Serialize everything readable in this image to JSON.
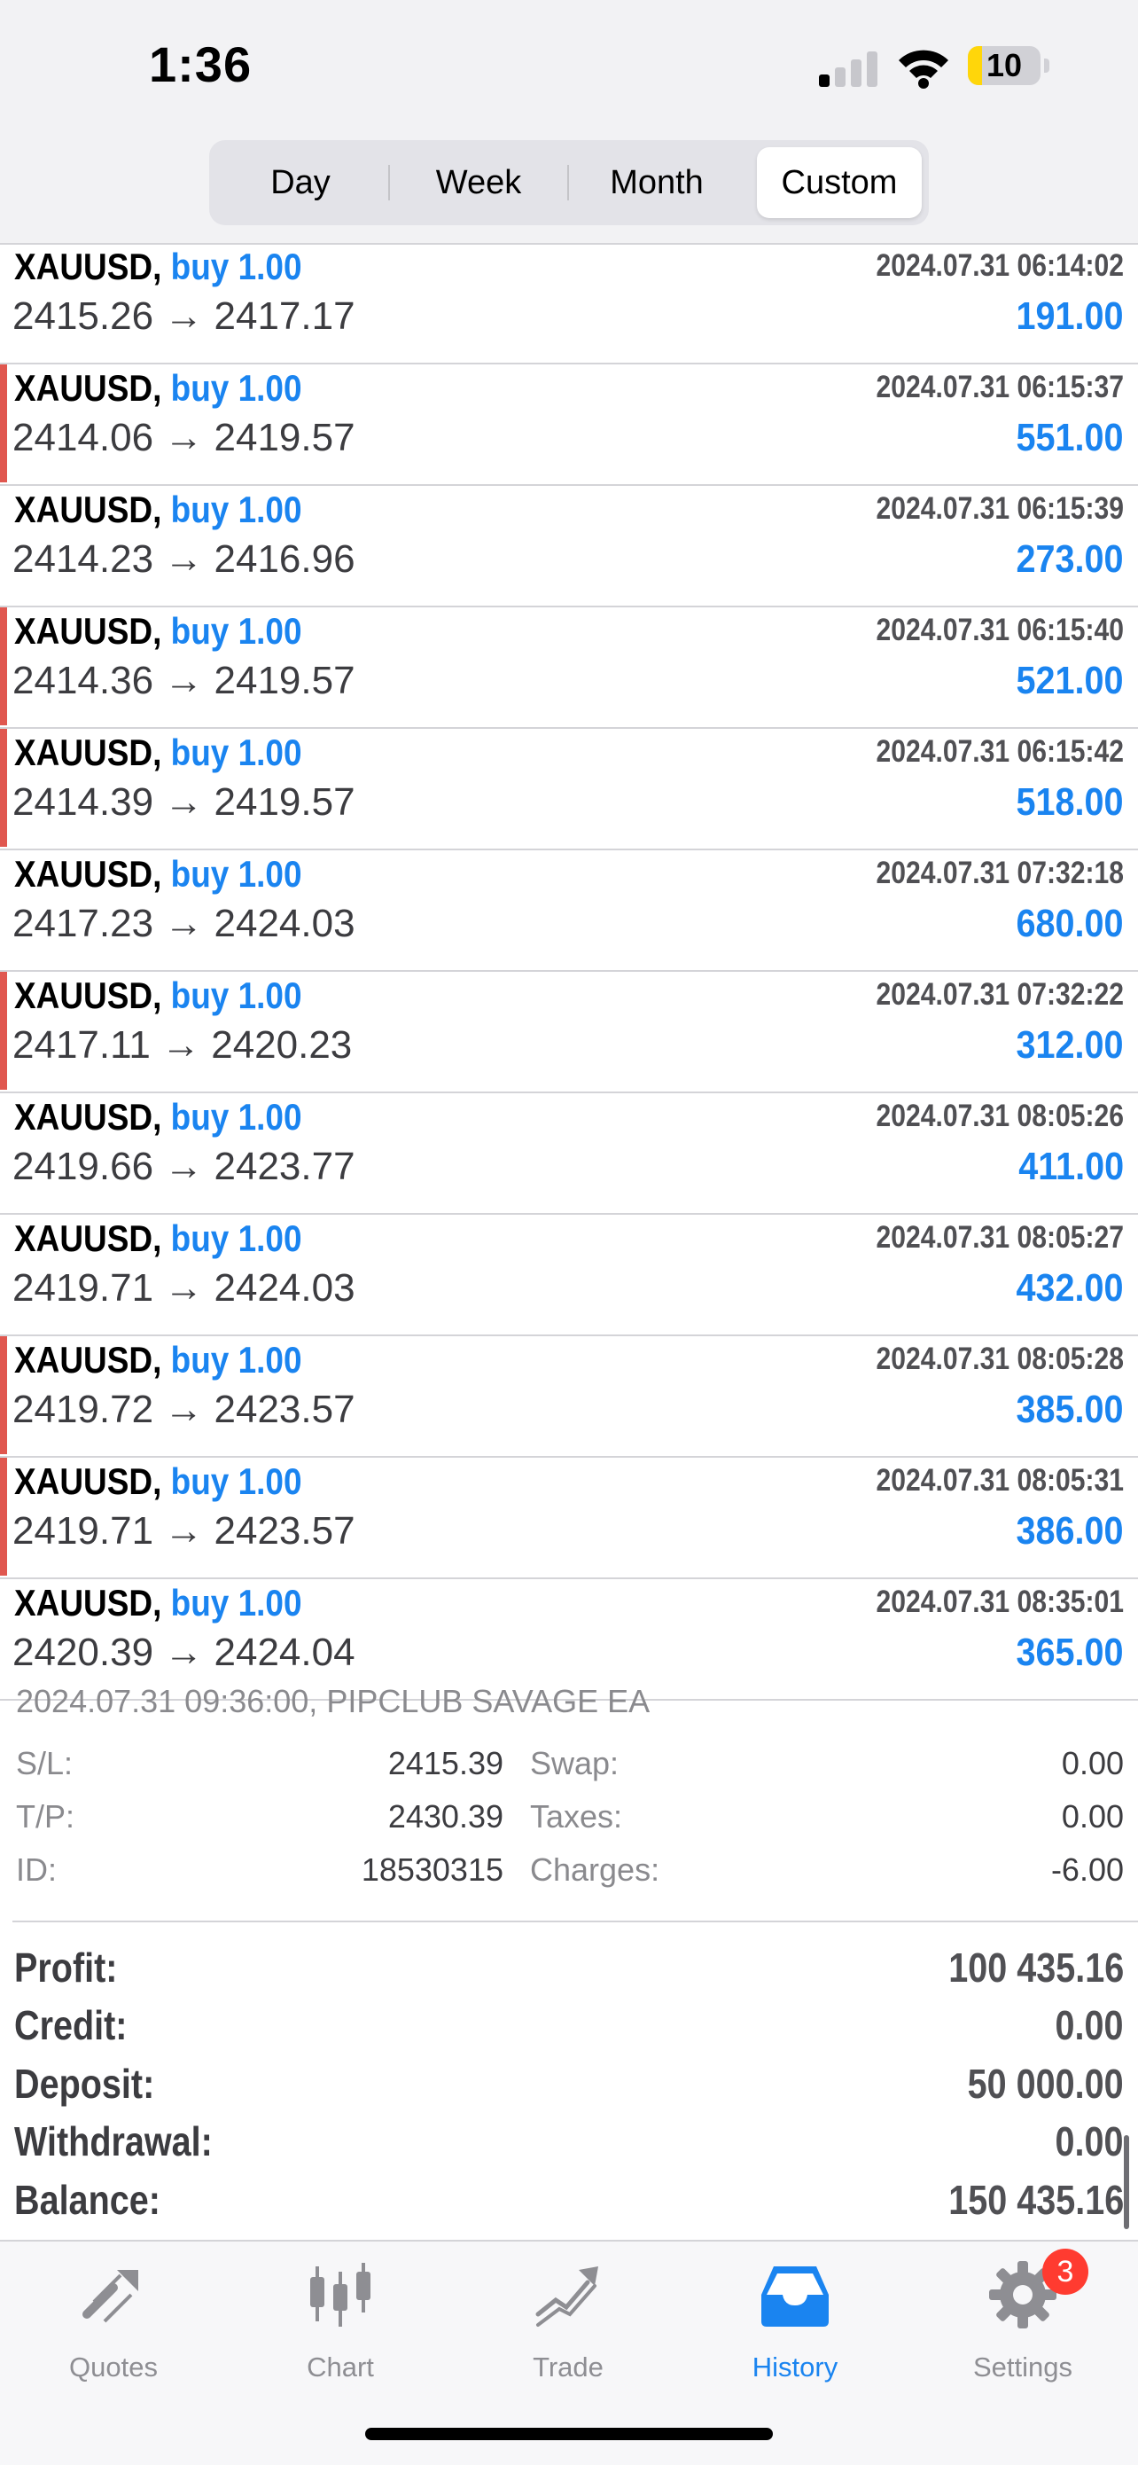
{
  "status_bar": {
    "time": "1:36",
    "battery": "10"
  },
  "segments": [
    "Day",
    "Week",
    "Month",
    "Custom"
  ],
  "selected_segment": "Custom",
  "deals": [
    {
      "symbol": "XAUUSD,",
      "type": "buy 1.00",
      "datetime": "2024.07.31 06:14:02",
      "prices": "2415.26 → 2417.17",
      "profit": "191.00",
      "marker": false
    },
    {
      "symbol": "XAUUSD,",
      "type": "buy 1.00",
      "datetime": "2024.07.31 06:15:37",
      "prices": "2414.06 → 2419.57",
      "profit": "551.00",
      "marker": true
    },
    {
      "symbol": "XAUUSD,",
      "type": "buy 1.00",
      "datetime": "2024.07.31 06:15:39",
      "prices": "2414.23 → 2416.96",
      "profit": "273.00",
      "marker": false
    },
    {
      "symbol": "XAUUSD,",
      "type": "buy 1.00",
      "datetime": "2024.07.31 06:15:40",
      "prices": "2414.36 → 2419.57",
      "profit": "521.00",
      "marker": true
    },
    {
      "symbol": "XAUUSD,",
      "type": "buy 1.00",
      "datetime": "2024.07.31 06:15:42",
      "prices": "2414.39 → 2419.57",
      "profit": "518.00",
      "marker": true
    },
    {
      "symbol": "XAUUSD,",
      "type": "buy 1.00",
      "datetime": "2024.07.31 07:32:18",
      "prices": "2417.23 → 2424.03",
      "profit": "680.00",
      "marker": false
    },
    {
      "symbol": "XAUUSD,",
      "type": "buy 1.00",
      "datetime": "2024.07.31 07:32:22",
      "prices": "2417.11 → 2420.23",
      "profit": "312.00",
      "marker": true
    },
    {
      "symbol": "XAUUSD,",
      "type": "buy 1.00",
      "datetime": "2024.07.31 08:05:26",
      "prices": "2419.66 → 2423.77",
      "profit": "411.00",
      "marker": false
    },
    {
      "symbol": "XAUUSD,",
      "type": "buy 1.00",
      "datetime": "2024.07.31 08:05:27",
      "prices": "2419.71 → 2424.03",
      "profit": "432.00",
      "marker": false
    },
    {
      "symbol": "XAUUSD,",
      "type": "buy 1.00",
      "datetime": "2024.07.31 08:05:28",
      "prices": "2419.72 → 2423.57",
      "profit": "385.00",
      "marker": true
    },
    {
      "symbol": "XAUUSD,",
      "type": "buy 1.00",
      "datetime": "2024.07.31 08:05:31",
      "prices": "2419.71 → 2423.57",
      "profit": "386.00",
      "marker": true
    },
    {
      "symbol": "XAUUSD,",
      "type": "buy 1.00",
      "datetime": "2024.07.31 08:35:01",
      "prices": "2420.39 → 2424.04",
      "profit": "365.00",
      "marker": false
    }
  ],
  "detail": {
    "comment": "2024.07.31 09:36:00, PIPCLUB SAVAGE EA",
    "sl_label": "S/L:",
    "sl_value": "2415.39",
    "tp_label": "T/P:",
    "tp_value": "2430.39",
    "id_label": "ID:",
    "id_value": "18530315",
    "swap_label": "Swap:",
    "swap_value": "0.00",
    "taxes_label": "Taxes:",
    "taxes_value": "0.00",
    "charges_label": "Charges:",
    "charges_value": "-6.00"
  },
  "summary": [
    {
      "label": "Profit:",
      "value": "100 435.16"
    },
    {
      "label": "Credit:",
      "value": "0.00"
    },
    {
      "label": "Deposit:",
      "value": "50 000.00"
    },
    {
      "label": "Withdrawal:",
      "value": "0.00"
    },
    {
      "label": "Balance:",
      "value": "150 435.16"
    }
  ],
  "tabs": [
    {
      "label": "Quotes",
      "icon": "quotes-icon"
    },
    {
      "label": "Chart",
      "icon": "chart-icon"
    },
    {
      "label": "Trade",
      "icon": "trade-icon"
    },
    {
      "label": "History",
      "icon": "history-icon"
    },
    {
      "label": "Settings",
      "icon": "gear-icon"
    }
  ],
  "active_tab": "History",
  "settings_badge": "3",
  "colors": {
    "accent": "#1a84f0",
    "marker": "#e0574f",
    "badge": "#ff3b30"
  }
}
